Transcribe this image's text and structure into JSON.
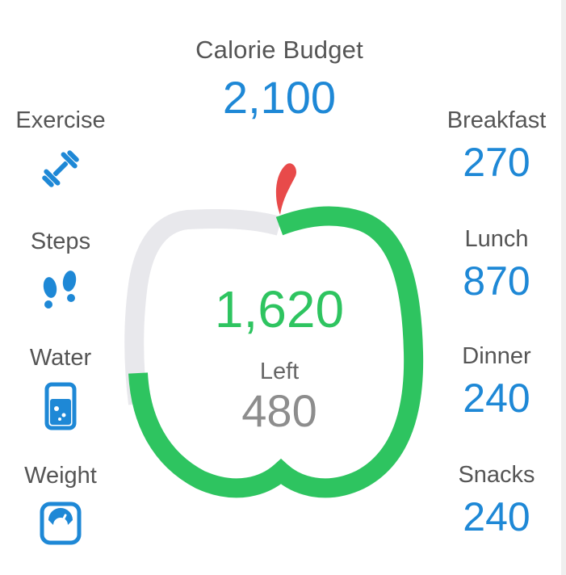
{
  "budget": {
    "label": "Calorie Budget",
    "value": "2,100"
  },
  "summary": {
    "consumed": "1,620",
    "left_label": "Left",
    "remaining": "480",
    "progress_fraction": 0.77
  },
  "trackers": [
    {
      "label": "Exercise",
      "icon": "dumbbell-icon"
    },
    {
      "label": "Steps",
      "icon": "footprints-icon"
    },
    {
      "label": "Water",
      "icon": "water-glass-icon"
    },
    {
      "label": "Weight",
      "icon": "scale-icon"
    }
  ],
  "meals": [
    {
      "label": "Breakfast",
      "value": "270"
    },
    {
      "label": "Lunch",
      "value": "870"
    },
    {
      "label": "Dinner",
      "value": "240"
    },
    {
      "label": "Snacks",
      "value": "240"
    }
  ],
  "colors": {
    "accent_blue": "#1e88d6",
    "progress_green": "#2ec460",
    "track_gray": "#e8e8ec",
    "stem_red": "#e84a4a",
    "remaining_gray": "#8d8d8d"
  }
}
